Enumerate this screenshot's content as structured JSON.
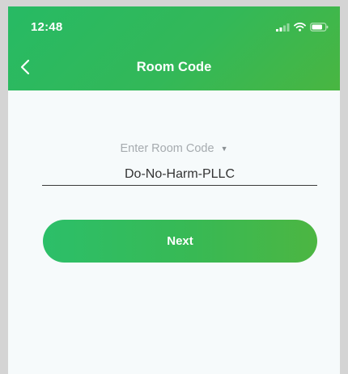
{
  "status_bar": {
    "time": "12:48",
    "icons": [
      "signal-icon",
      "wifi-icon",
      "battery-icon"
    ]
  },
  "header": {
    "back_icon": "chevron-left-icon",
    "title": "Room Code"
  },
  "form": {
    "code_label": "Enter Room Code",
    "dropdown_caret": "▼",
    "code_value": "Do-No-Harm-PLLC",
    "next_label": "Next"
  },
  "colors": {
    "brand_green": "#2ebc63",
    "brand_green_light": "#4cb642",
    "background": "#f6fafb"
  }
}
